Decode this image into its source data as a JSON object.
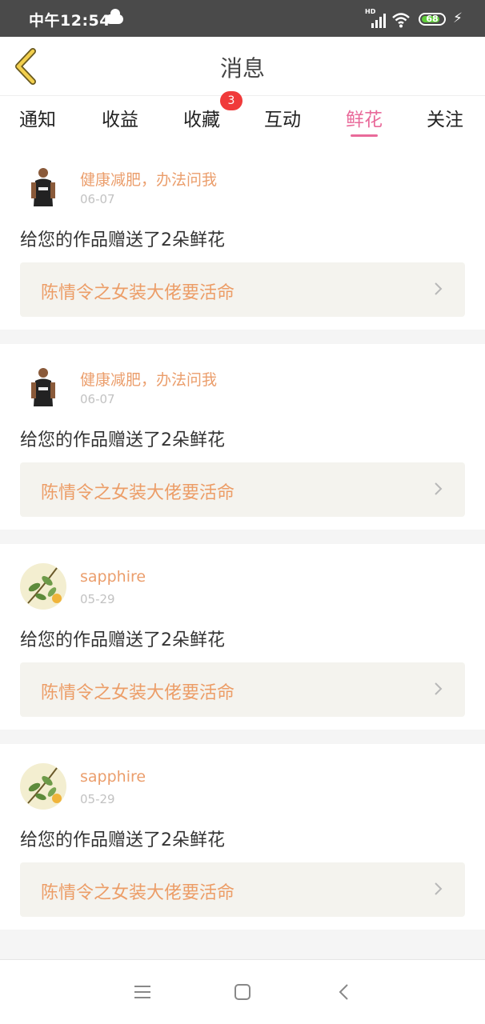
{
  "status_bar": {
    "time": "中午12:54",
    "network": "HD",
    "battery": "68"
  },
  "header": {
    "title": "消息",
    "back_icon": "chevron-left-icon"
  },
  "tabs": [
    {
      "label": "通知",
      "active": false
    },
    {
      "label": "收益",
      "active": false
    },
    {
      "label": "收藏",
      "active": false,
      "badge": "3"
    },
    {
      "label": "互动",
      "active": false
    },
    {
      "label": "鲜花",
      "active": true
    },
    {
      "label": "关注",
      "active": false
    }
  ],
  "colors": {
    "accent": "#e96a9a",
    "name": "#eb9e6c",
    "badge": "#f03a3a"
  },
  "messages": [
    {
      "user": "健康减肥，办法问我",
      "date": "06-07",
      "text": "给您的作品赠送了2朵鲜花",
      "work": "陈情令之女装大佬要活命",
      "avatar": "person"
    },
    {
      "user": "健康减肥，办法问我",
      "date": "06-07",
      "text": "给您的作品赠送了2朵鲜花",
      "work": "陈情令之女装大佬要活命",
      "avatar": "person"
    },
    {
      "user": "sapphire",
      "date": "05-29",
      "text": "给您的作品赠送了2朵鲜花",
      "work": "陈情令之女装大佬要活命",
      "avatar": "plant"
    },
    {
      "user": "sapphire",
      "date": "05-29",
      "text": "给您的作品赠送了2朵鲜花",
      "work": "陈情令之女装大佬要活命",
      "avatar": "plant"
    }
  ],
  "nav": {
    "menu_icon": "menu-icon",
    "home_icon": "home-square-icon",
    "back_icon": "back-triangle-icon"
  }
}
